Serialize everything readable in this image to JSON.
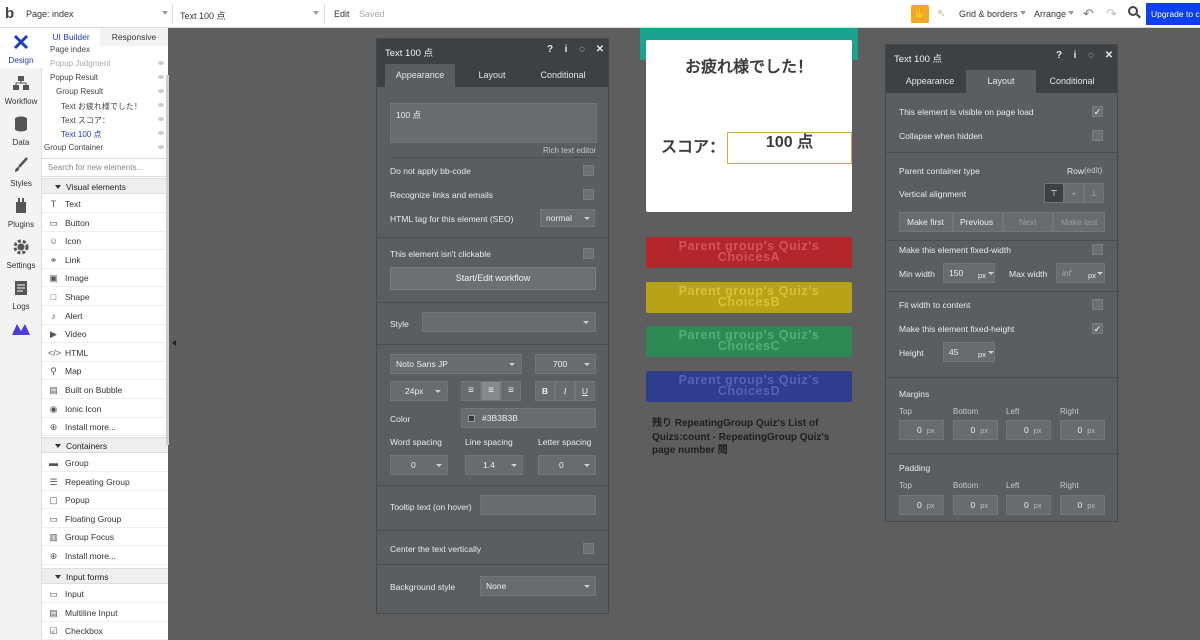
{
  "topbar": {
    "page_label": "Page: index",
    "selected_element": "Text 100 点",
    "edit": "Edit",
    "saved": "Saved",
    "grid": "Grid & borders",
    "arrange": "Arrange",
    "upgrade": "Upgrade to c"
  },
  "rail": [
    {
      "label": "Design",
      "icon": "design-icon"
    },
    {
      "label": "Workflow",
      "icon": "workflow-icon"
    },
    {
      "label": "Data",
      "icon": "data-icon"
    },
    {
      "label": "Styles",
      "icon": "styles-icon"
    },
    {
      "label": "Plugins",
      "icon": "plugins-icon"
    },
    {
      "label": "Settings",
      "icon": "settings-icon"
    },
    {
      "label": "Logs",
      "icon": "logs-icon"
    }
  ],
  "panel": {
    "tab_builder": "UI Builder",
    "tab_responsive": "Responsive",
    "tree": [
      "Page index",
      "Popup Judgment",
      "Popup Result",
      "Group Result",
      "Text お疲れ様でした！",
      "Text スコア：",
      "Text 100 点",
      "Group Container"
    ],
    "search_placeholder": "Search for new elements...",
    "sections": {
      "visual": "Visual elements",
      "containers": "Containers",
      "inputs": "Input forms"
    },
    "visual": [
      "Text",
      "Button",
      "Icon",
      "Link",
      "Image",
      "Shape",
      "Alert",
      "Video",
      "HTML",
      "Map",
      "Built on Bubble",
      "Ionic Icon",
      "Install more..."
    ],
    "containers": [
      "Group",
      "Repeating Group",
      "Popup",
      "Floating Group",
      "Group Focus",
      "Install more..."
    ],
    "inputs": [
      "Input",
      "Multiline Input",
      "Checkbox"
    ]
  },
  "editor1": {
    "title": "Text 100 点",
    "tabs": [
      "Appearance",
      "Layout",
      "Conditional"
    ],
    "content": "100 点",
    "rich": "Rich text editor",
    "bbcode": "Do not apply bb-code",
    "links": "Recognize links and emails",
    "htmltag": "HTML tag for this element (SEO)",
    "htmltag_value": "normal",
    "notclickable": "This element isn't clickable",
    "workflow": "Start/Edit workflow",
    "style": "Style",
    "font": "Noto Sans JP",
    "weight": "700",
    "size": "24px",
    "bold": "B",
    "italic": "I",
    "underline": "U",
    "color_label": "Color",
    "color_value": "#3B3B3B",
    "color": "#3B3B3B",
    "word": "Word spacing",
    "line": "Line spacing",
    "letter": "Letter spacing",
    "word_val": "0",
    "line_val": "1.4",
    "letter_val": "0",
    "tooltip": "Tooltip text (on hover)",
    "center": "Center the text vertically",
    "bgstyle": "Background style",
    "bg_value": "None"
  },
  "editor2": {
    "title": "Text 100 点",
    "tabs": [
      "Appearance",
      "Layout",
      "Conditional"
    ],
    "visible": "This element is visible on page load",
    "collapse": "Collapse when hidden",
    "parent_type": "Parent container type",
    "parent_value": "Row",
    "parent_edit": "(edit)",
    "valign": "Vertical alignment",
    "make_first": "Make first",
    "previous": "Previous",
    "next": "Next",
    "make_last": "Make last",
    "fixed_width": "Make this element fixed-width",
    "min_width": "Min width",
    "min_width_val": "150",
    "max_width": "Max width",
    "max_width_val": "inf",
    "px": "px",
    "fit": "Fit width to content",
    "fixed_height": "Make this element fixed-height",
    "height": "Height",
    "height_val": "45",
    "margins": "Margins",
    "padding": "Padding",
    "top": "Top",
    "bottom": "Bottom",
    "left": "Left",
    "right": "Right",
    "zero": "0"
  },
  "canvas": {
    "popup_title": "お疲れ様でした！",
    "score_label": "スコア：",
    "score_value": "100 点",
    "choices": [
      {
        "text": "Parent group's Quiz's ChoicesA",
        "color": "#b3262b",
        "text_color": "#d4545a"
      },
      {
        "text": "Parent group's Quiz's ChoicesB",
        "color": "#b8a317",
        "text_color": "#d6c23a"
      },
      {
        "text": "Parent group's Quiz's ChoicesC",
        "color": "#2d8a55",
        "text_color": "#4fb079"
      },
      {
        "text": "Parent group's Quiz's ChoicesD",
        "color": "#2f3d8f",
        "text_color": "#5563b5"
      }
    ],
    "remaining": "残り RepeatingGroup Quiz's List of Quizs:count - RepeatingGroup Quiz's page number 問"
  }
}
